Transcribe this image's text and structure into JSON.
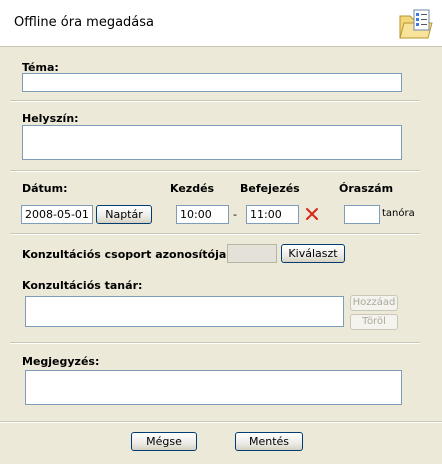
{
  "dialog": {
    "title": "Offline óra megadása"
  },
  "form": {
    "tema_label": "Téma:",
    "tema_value": "",
    "helyszin_label": "Helyszín:",
    "helyszin_value": "",
    "datum_label": "Dátum:",
    "datum_value": "2008-05-01",
    "naptar_button": "Naptár",
    "kezdes_label": "Kezdés",
    "kezdes_value": "10:00",
    "dash": "-",
    "befejezes_label": "Befejezés",
    "befejezes_value": "11:00",
    "oraszam_label": "Óraszám",
    "oraszam_value": "",
    "oraszam_unit": "tanóra",
    "csoport_label": "Konzultációs csoport azonosítója:",
    "csoport_value": "",
    "kivalaszt_button": "Kiválaszt",
    "tanar_label": "Konzultációs tanár:",
    "tanar_value": "",
    "hozzaad_button": "Hozzáad",
    "torol_button": "Töröl",
    "megjegyzes_label": "Megjegyzés:",
    "megjegyzes_value": ""
  },
  "footer": {
    "megse_button": "Mégse",
    "mentes_button": "Mentés"
  },
  "icons": {
    "header": "folder-checklist-icon",
    "clear_time": "red-x-icon"
  },
  "colors": {
    "background": "#ece9d8",
    "header_bg": "#ffffff",
    "input_border": "#7f9db9",
    "button_border": "#003c74",
    "clear_x": "#d42a1c"
  }
}
